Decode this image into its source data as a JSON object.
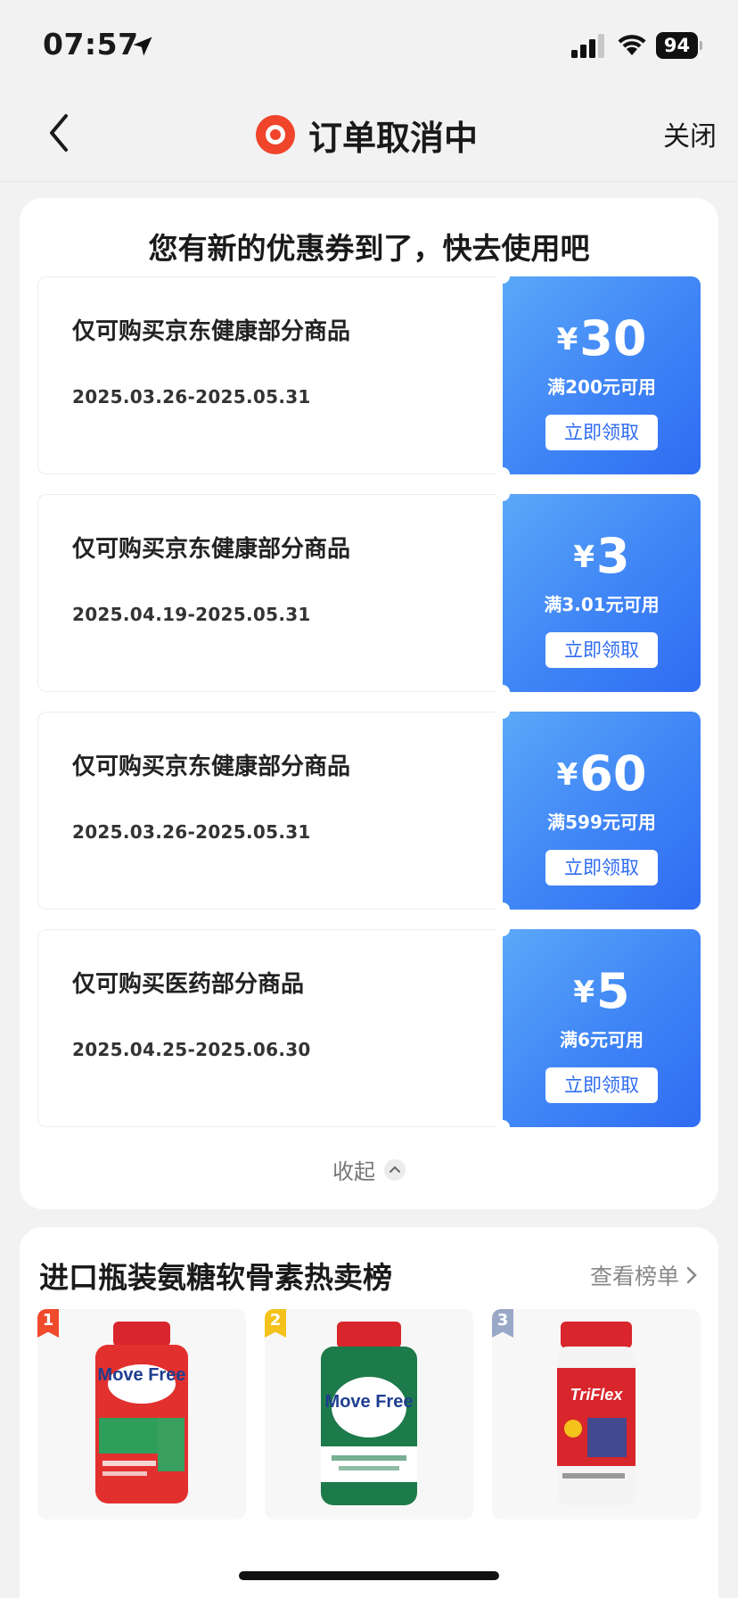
{
  "status_bar": {
    "time": "07:57",
    "battery": "94"
  },
  "nav": {
    "title": "订单取消中",
    "close_label": "关闭"
  },
  "coupons": {
    "heading": "您有新的优惠券到了，快去使用吧",
    "items": [
      {
        "description": "仅可购买京东健康部分商品",
        "date_range": "2025.03.26-2025.05.31",
        "currency": "¥",
        "amount": "30",
        "condition": "满200元可用",
        "button": "立即领取"
      },
      {
        "description": "仅可购买京东健康部分商品",
        "date_range": "2025.04.19-2025.05.31",
        "currency": "¥",
        "amount": "3",
        "condition": "满3.01元可用",
        "button": "立即领取"
      },
      {
        "description": "仅可购买京东健康部分商品",
        "date_range": "2025.03.26-2025.05.31",
        "currency": "¥",
        "amount": "60",
        "condition": "满599元可用",
        "button": "立即领取"
      },
      {
        "description": "仅可购买医药部分商品",
        "date_range": "2025.04.25-2025.06.30",
        "currency": "¥",
        "amount": "5",
        "condition": "满6元可用",
        "button": "立即领取"
      }
    ],
    "collapse_label": "收起"
  },
  "ranking": {
    "title": "进口瓶装氨糖软骨素热卖榜",
    "more_label": "查看榜单",
    "products": [
      {
        "rank": "1",
        "badge_color": "#f04a2c",
        "brand_text": "Move Free",
        "cap_color": "#d8262c",
        "label_color": "#e2302f"
      },
      {
        "rank": "2",
        "badge_color": "#f3c21b",
        "brand_text": "Move Free",
        "cap_color": "#d8262c",
        "label_color": "#1d7a4a"
      },
      {
        "rank": "3",
        "badge_color": "#9aa8c8",
        "brand_text": "TriFlex",
        "cap_color": "#d8262c",
        "label_color": "#d8262c"
      }
    ]
  },
  "colors": {
    "accent_blue": "#3f84f6",
    "jd_red": "#f0442b"
  }
}
